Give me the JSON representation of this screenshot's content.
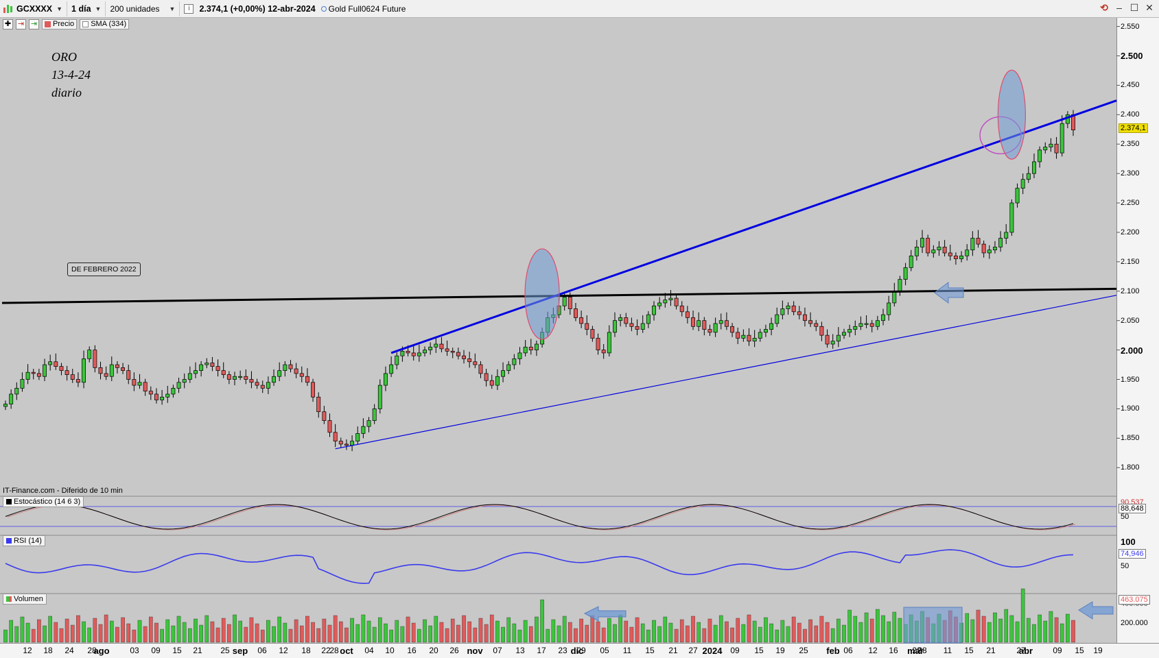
{
  "toolbar": {
    "symbol": "GCXXXX",
    "interval": "1 día",
    "units": "200 unidades",
    "info_icon": "i",
    "quote": "2.374,1 (+0,00%) 12-abr-2024",
    "instrument": "Gold Full0624 Future"
  },
  "legend": {
    "precio": "Precio",
    "sma": "SMA (334)"
  },
  "annotation": {
    "line1": "ORO",
    "line2": "13-4-24",
    "line3": "diario",
    "box_label": "DE FEBRERO 2022"
  },
  "source_note": "IT-Finance.com - Diferido de 10 min",
  "panes": {
    "stochastic": {
      "label": "Estocástico (14 6 3)",
      "value": "88,648",
      "value_hidden": "90,537",
      "tick_50": "50"
    },
    "rsi": {
      "label": "RSI (14)",
      "value": "74,946",
      "tick_100": "100",
      "tick_50": "50"
    },
    "volume": {
      "label": "Volumen",
      "value": "463.075",
      "tick_400": "400.000",
      "tick_200": "200.000"
    }
  },
  "price_axis": {
    "current": "2.374,1",
    "ticks": [
      "2.550",
      "2.500",
      "2.450",
      "2.400",
      "2.350",
      "2.300",
      "2.250",
      "2.200",
      "2.150",
      "2.100",
      "2.050",
      "2.000",
      "1.950",
      "1.900",
      "1.850",
      "1.800"
    ],
    "bold_ticks": [
      "2.500",
      "2.000"
    ]
  },
  "time_axis": {
    "labels": [
      "12",
      "18",
      "24",
      "28",
      "ago",
      "03",
      "09",
      "15",
      "21",
      "25",
      "sep",
      "06",
      "12",
      "18",
      "22",
      "28",
      "oct",
      "04",
      "10",
      "16",
      "20",
      "26",
      "nov",
      "07",
      "13",
      "17",
      "23",
      "29",
      "dic",
      "05",
      "11",
      "15",
      "21",
      "27",
      "2024",
      "09",
      "15",
      "19",
      "25",
      "feb",
      "06",
      "12",
      "16",
      "22",
      "28",
      "mar",
      "11",
      "15",
      "21",
      "27",
      "abr",
      "09",
      "15",
      "19"
    ],
    "bold_labels": [
      "ago",
      "sep",
      "oct",
      "nov",
      "dic",
      "2024",
      "feb",
      "mar",
      "abr"
    ]
  },
  "colors": {
    "chart_bg": "#c8c8c8",
    "up": "#3cc43c",
    "down": "#e05a5a",
    "trendline": "#0000e0",
    "support": "#000000",
    "highlight_box": "#6f9ad6"
  },
  "chart_data": {
    "type": "candlestick",
    "instrument": "Gold Full0624 Future",
    "interval": "1 día",
    "ylim": [
      1770,
      2560
    ],
    "closes": [
      1908,
      1925,
      1935,
      1950,
      1962,
      1960,
      1955,
      1975,
      1980,
      1972,
      1965,
      1958,
      1950,
      1945,
      1985,
      2000,
      1970,
      1960,
      1955,
      1975,
      1970,
      1965,
      1950,
      1940,
      1945,
      1930,
      1925,
      1915,
      1920,
      1925,
      1935,
      1945,
      1950,
      1960,
      1965,
      1975,
      1978,
      1972,
      1965,
      1958,
      1950,
      1955,
      1955,
      1950,
      1945,
      1940,
      1935,
      1945,
      1955,
      1965,
      1975,
      1968,
      1960,
      1955,
      1945,
      1920,
      1895,
      1880,
      1860,
      1845,
      1840,
      1838,
      1845,
      1858,
      1870,
      1880,
      1900,
      1940,
      1960,
      1975,
      1990,
      1998,
      1995,
      1990,
      1995,
      2000,
      2005,
      2010,
      2002,
      1998,
      1996,
      1990,
      1985,
      1980,
      1975,
      1960,
      1948,
      1940,
      1955,
      1965,
      1975,
      1985,
      1995,
      2005,
      2000,
      2010,
      2030,
      2055,
      2060,
      2075,
      2090,
      2070,
      2055,
      2045,
      2035,
      2020,
      2000,
      1995,
      2030,
      2050,
      2055,
      2045,
      2040,
      2035,
      2045,
      2060,
      2075,
      2080,
      2085,
      2088,
      2075,
      2065,
      2055,
      2040,
      2050,
      2035,
      2030,
      2045,
      2050,
      2040,
      2030,
      2020,
      2025,
      2015,
      2020,
      2030,
      2035,
      2045,
      2060,
      2070,
      2075,
      2065,
      2060,
      2050,
      2045,
      2040,
      2025,
      2010,
      2015,
      2025,
      2030,
      2035,
      2040,
      2045,
      2045,
      2040,
      2050,
      2060,
      2080,
      2100,
      2120,
      2140,
      2160,
      2175,
      2190,
      2165,
      2170,
      2175,
      2165,
      2160,
      2155,
      2160,
      2170,
      2190,
      2180,
      2165,
      2170,
      2175,
      2190,
      2200,
      2250,
      2275,
      2290,
      2300,
      2320,
      2340,
      2345,
      2350,
      2335,
      2385,
      2400,
      2374
    ]
  }
}
